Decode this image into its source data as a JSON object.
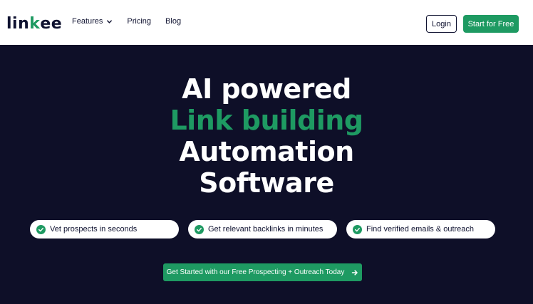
{
  "nav": {
    "logo_prefix": "lin",
    "logo_mark": "k",
    "logo_suffix": "ee",
    "links": {
      "features": "Features",
      "pricing": "Pricing",
      "blog": "Blog"
    },
    "login_label": "Login",
    "start_label": "Start for Free"
  },
  "hero": {
    "headline_line1": "AI powered",
    "headline_line2": "Link building",
    "headline_line3": "Automation",
    "headline_line4": "Software",
    "pills": {
      "p1": "Vet prospects in seconds",
      "p2": "Get relevant backlinks in minutes",
      "p3": "Find verified emails & outreach"
    },
    "cta_label": "Get Started with our Free Prospecting + Outreach Today"
  },
  "colors": {
    "brand_green": "#1e9a62",
    "hero_bg": "#0e0f28",
    "text_dark": "#0f1230"
  },
  "icons": {
    "features_dropdown": "chevron-down-icon",
    "pill_check": "check-circle-icon",
    "cta_arrow": "arrow-right-icon"
  }
}
